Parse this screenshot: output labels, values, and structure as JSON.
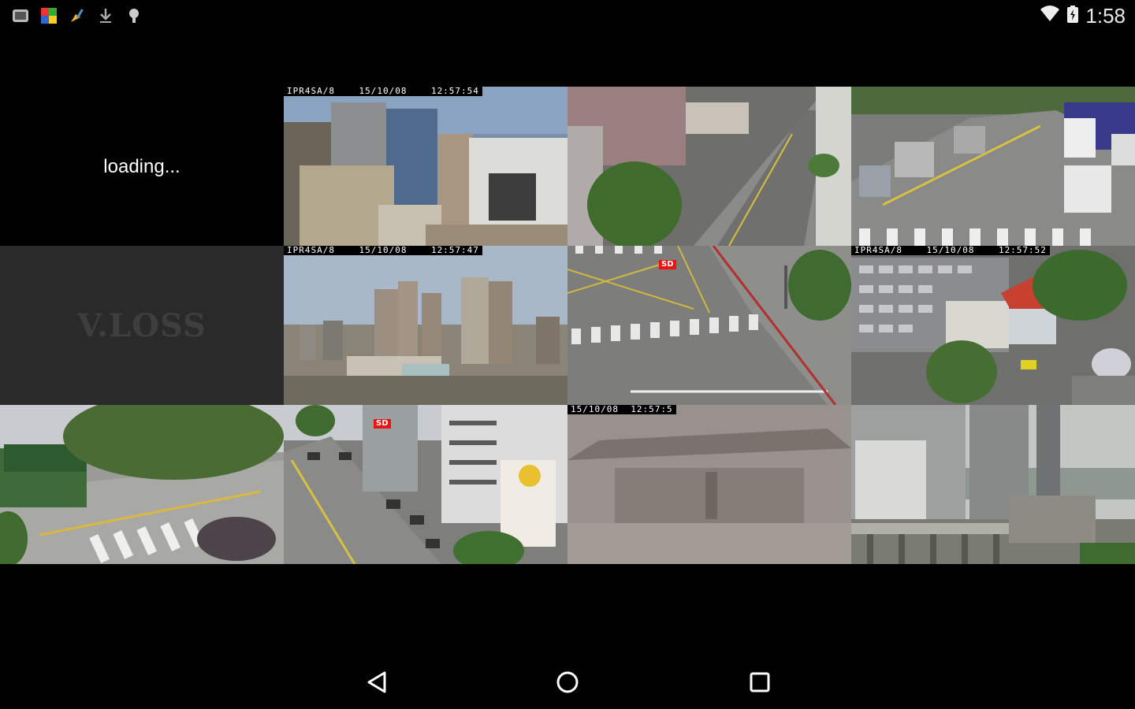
{
  "status_bar": {
    "time": "1:58",
    "left_icons": [
      "gallery-app-icon",
      "colorful-app-icon",
      "broom-cleaner-icon",
      "download-icon",
      "android-debug-icon"
    ],
    "right_icons": [
      "wifi-icon",
      "battery-icon"
    ]
  },
  "cameras": [
    {
      "id": 1,
      "status": "loading",
      "label": "loading..."
    },
    {
      "id": 2,
      "status": "live",
      "osd": "IPR4SA/8    15/10/08    12:57:54"
    },
    {
      "id": 3,
      "status": "live"
    },
    {
      "id": 4,
      "status": "live"
    },
    {
      "id": 5,
      "status": "video-loss",
      "label": "V.LOSS"
    },
    {
      "id": 6,
      "status": "live",
      "osd": "IPR4SA/8    15/10/08    12:57:47"
    },
    {
      "id": 7,
      "status": "live",
      "badge": "SD"
    },
    {
      "id": 8,
      "status": "live",
      "osd": "IPR4SA/8    15/10/08    12:57:52"
    },
    {
      "id": 9,
      "status": "live"
    },
    {
      "id": 10,
      "status": "live",
      "badge": "SD"
    },
    {
      "id": 11,
      "status": "live",
      "osd": "15/10/08  12:57:5"
    },
    {
      "id": 12,
      "status": "live"
    }
  ],
  "nav_bar": {
    "buttons": [
      "back-icon",
      "home-icon",
      "recents-icon"
    ]
  },
  "colors": {
    "background": "#000000",
    "vloss_cell": "#2a2a2a",
    "badge": "#e11111"
  }
}
